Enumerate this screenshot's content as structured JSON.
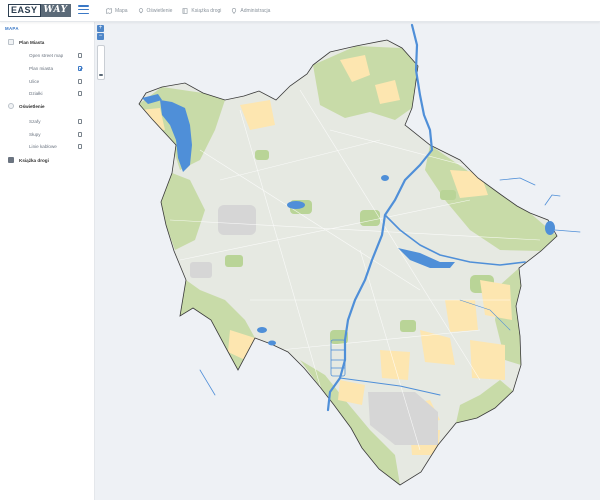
{
  "app": {
    "logo_text_1": "EASY",
    "logo_text_2": "WAY"
  },
  "nav": [
    {
      "label": "Mapa",
      "icon": "map-icon"
    },
    {
      "label": "Oświetlenie",
      "icon": "bulb-icon"
    },
    {
      "label": "Książka drogi",
      "icon": "book-icon"
    },
    {
      "label": "Administracja",
      "icon": "marker-icon"
    }
  ],
  "sidebar": {
    "title": "MAPA",
    "groups": [
      {
        "label": "Plan Miasta",
        "items": [
          {
            "label": "Open street map",
            "checked": false
          },
          {
            "label": "Plan miasta",
            "checked": true
          },
          {
            "label": "Ulice",
            "checked": false
          },
          {
            "label": "Działki",
            "checked": false
          }
        ]
      },
      {
        "label": "Oświetlenie",
        "items": [
          {
            "label": "Szafy",
            "checked": false
          },
          {
            "label": "Słupy",
            "checked": false
          },
          {
            "label": "Linie kablowe",
            "checked": false
          }
        ]
      },
      {
        "label": "Książka drogi",
        "items": []
      }
    ]
  },
  "zoom": {
    "in_label": "+",
    "out_label": "−"
  },
  "colors": {
    "accent": "#3a78c6",
    "map_background": "#eef1f5",
    "city_base": "#e9ebe4",
    "green_area": "#c8dba8",
    "residential_area": "#fde6b0",
    "water": "#4f8fd8",
    "industrial_area": "#d9d9d9"
  }
}
